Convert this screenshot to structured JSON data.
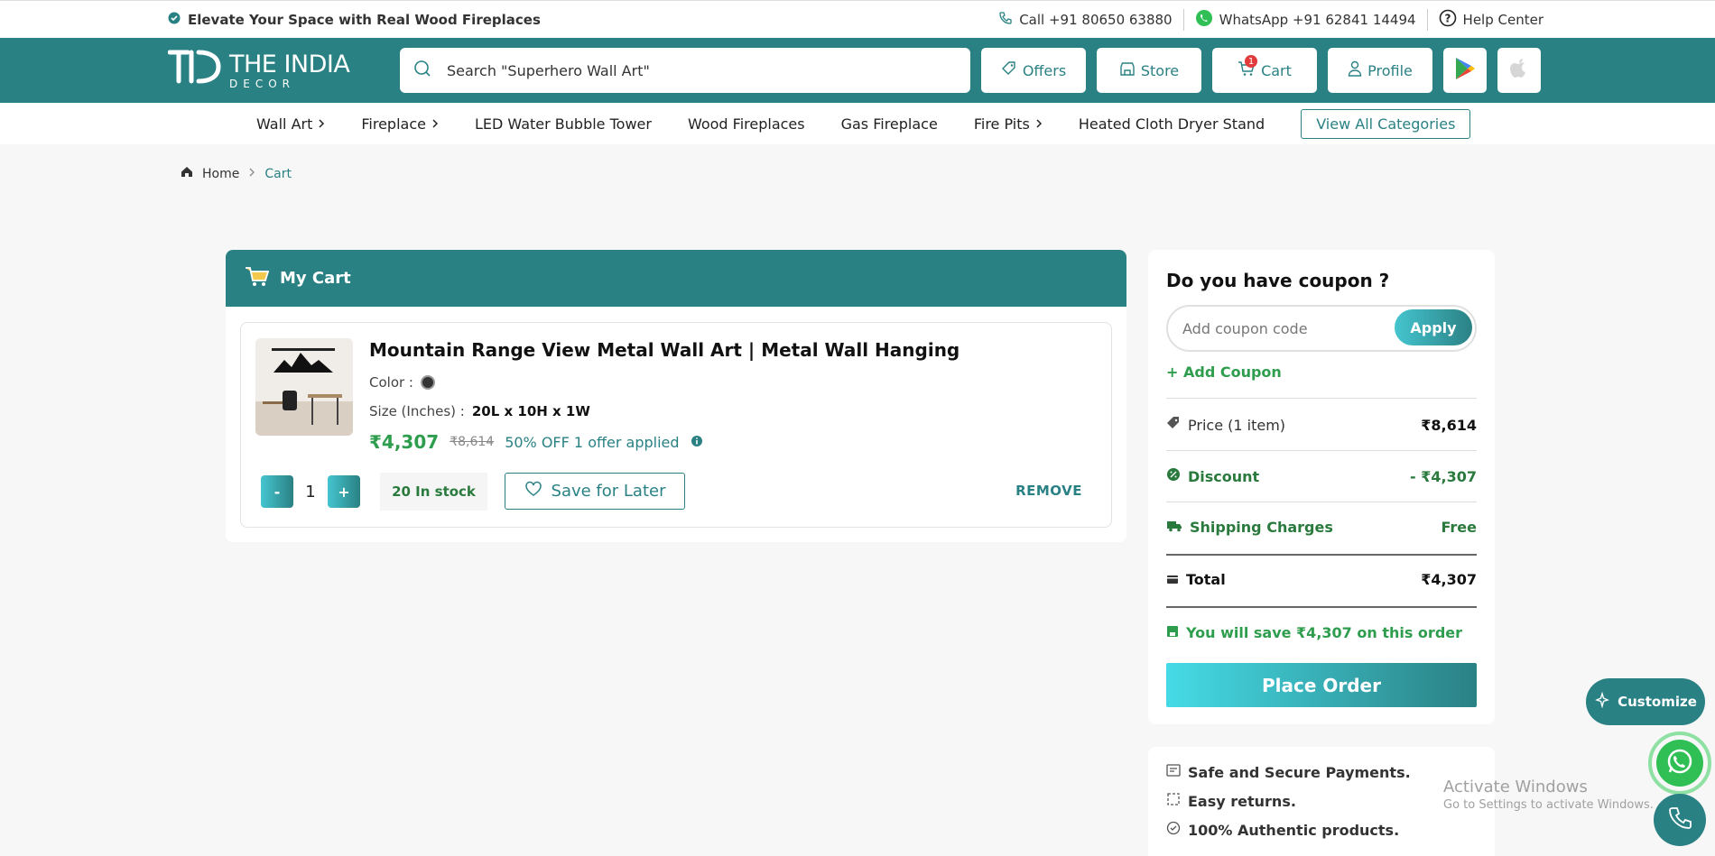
{
  "topbar": {
    "promo": "Elevate Your Space with Real Wood Fireplaces",
    "call": "Call +91 80650 63880",
    "whatsapp": "WhatsApp +91 62841 14494",
    "help": "Help Center"
  },
  "brand": {
    "name_line1": "THE INDIA",
    "name_line2": "DECOR"
  },
  "search": {
    "placeholder": "Search \"Superhero Wall Art\""
  },
  "header_buttons": {
    "offers": "Offers",
    "store": "Store",
    "cart": "Cart",
    "cart_count": "1",
    "profile": "Profile"
  },
  "nav": {
    "items": [
      "Wall Art",
      "Fireplace",
      "LED Water Bubble Tower",
      "Wood Fireplaces",
      "Gas Fireplace",
      "Fire Pits",
      "Heated Cloth Dryer Stand"
    ],
    "view_all": "View All Categories"
  },
  "breadcrumb": {
    "home": "Home",
    "current": "Cart"
  },
  "cart": {
    "title": "My Cart",
    "item": {
      "name": "Mountain Range View Metal Wall Art | Metal Wall Hanging",
      "color_label": "Color :",
      "color_hex": "#333333",
      "size_label": "Size (Inches) :",
      "size_value": "20L x 10H x 1W",
      "price": "₹4,307",
      "mrp": "₹8,614",
      "offer": "50% OFF 1 offer applied",
      "qty_minus": "-",
      "qty": "1",
      "qty_plus": "+",
      "stock": "20 In stock",
      "save_for_later": "Save for Later",
      "remove": "REMOVE"
    }
  },
  "summary": {
    "coupon_title": "Do you have coupon ?",
    "coupon_placeholder": "Add coupon code",
    "apply": "Apply",
    "add_coupon": "+ Add Coupon",
    "price_label": "Price (1 item)",
    "price_value": "₹8,614",
    "discount_label": "Discount",
    "discount_value": "- ₹4,307",
    "shipping_label": "Shipping Charges",
    "shipping_value": "Free",
    "total_label": "Total",
    "total_value": "₹4,307",
    "save_note": "You will save ₹4,307 on this order",
    "place_order": "Place Order"
  },
  "trust": [
    "Safe and Secure Payments.",
    "Easy returns.",
    "100% Authentic products."
  ],
  "floating": {
    "customize": "Customize"
  },
  "watermark": {
    "line1": "Activate Windows",
    "line2": "Go to Settings to activate Windows."
  },
  "colors": {
    "brand": "#2a8184",
    "green": "#2e9d4d",
    "accent_gradient": "#45c5cf"
  }
}
